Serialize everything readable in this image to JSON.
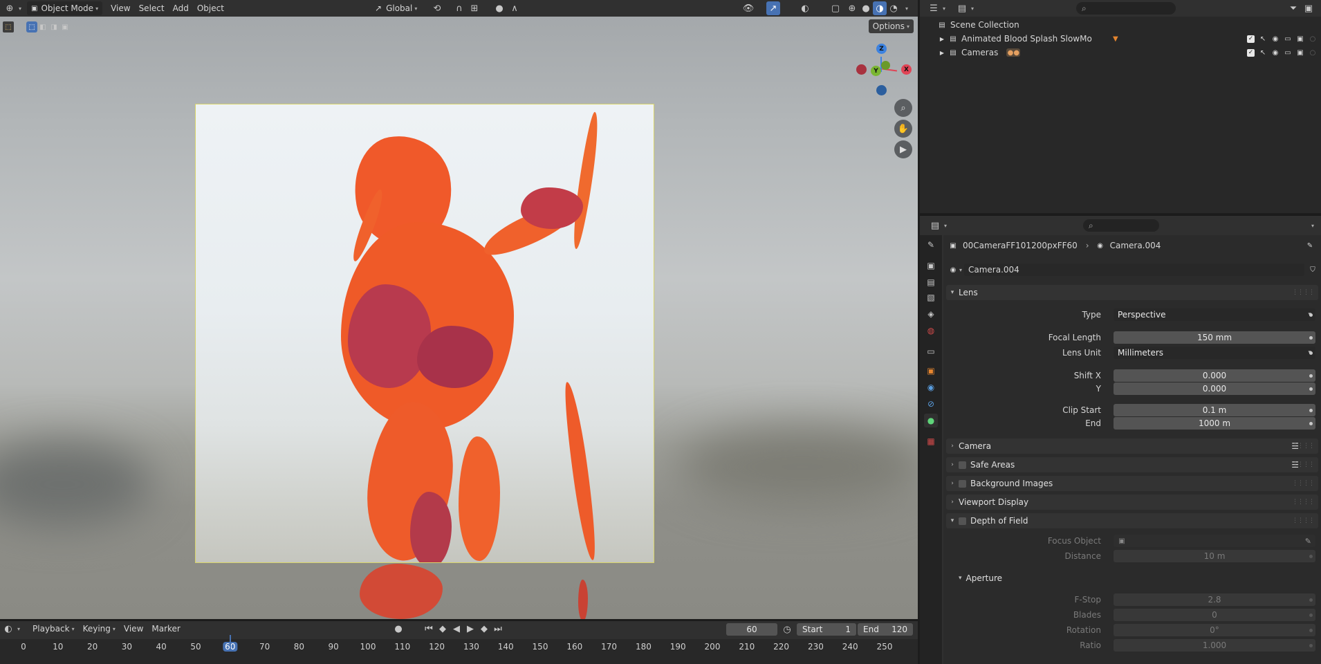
{
  "viewport": {
    "mode_label": "Object Mode",
    "menus": [
      "View",
      "Select",
      "Add",
      "Object"
    ],
    "transform_orientation": "Global",
    "options_label": "Options",
    "gizmo": {
      "z": "Z",
      "x": "X",
      "y": "Y"
    }
  },
  "timeline": {
    "menus": [
      "Playback",
      "Keying",
      "View",
      "Marker"
    ],
    "current_frame": "60",
    "start_label": "Start",
    "start_value": "1",
    "end_label": "End",
    "end_value": "120",
    "ticks": [
      "0",
      "10",
      "20",
      "30",
      "40",
      "50",
      "60",
      "70",
      "80",
      "90",
      "100",
      "110",
      "120",
      "130",
      "140",
      "150",
      "160",
      "170",
      "180",
      "190",
      "200",
      "210",
      "220",
      "230",
      "240",
      "250"
    ]
  },
  "outliner": {
    "scene_collection": "Scene Collection",
    "items": [
      {
        "label": "Animated Blood Splash SlowMo"
      },
      {
        "label": "Cameras"
      }
    ]
  },
  "properties": {
    "breadcrumb_object": "00CameraFF101200pxFF60",
    "breadcrumb_data": "Camera.004",
    "datablock_name": "Camera.004",
    "lens_panel": "Lens",
    "type_label": "Type",
    "type_value": "Perspective",
    "focal_label": "Focal Length",
    "focal_value": "150 mm",
    "lens_unit_label": "Lens Unit",
    "lens_unit_value": "Millimeters",
    "shift_x_label": "Shift X",
    "shift_x_value": "0.000",
    "shift_y_label": "Y",
    "shift_y_value": "0.000",
    "clip_start_label": "Clip Start",
    "clip_start_value": "0.1 m",
    "clip_end_label": "End",
    "clip_end_value": "1000 m",
    "panels": {
      "camera": "Camera",
      "safe_areas": "Safe Areas",
      "background_images": "Background Images",
      "viewport_display": "Viewport Display",
      "depth_of_field": "Depth of Field"
    },
    "focus_object_label": "Focus Object",
    "distance_label": "Distance",
    "distance_value": "10 m",
    "aperture_panel": "Aperture",
    "fstop_label": "F-Stop",
    "fstop_value": "2.8",
    "blades_label": "Blades",
    "blades_value": "0",
    "rotation_label": "Rotation",
    "rotation_value": "0°",
    "ratio_label": "Ratio",
    "ratio_value": "1.000"
  },
  "colors": {
    "accent": "#4772b3",
    "splash": "#f05a28",
    "splash_dark": "#a8324a",
    "axis_x": "#e04455",
    "axis_y": "#7ab631",
    "axis_z": "#3c82e0"
  }
}
